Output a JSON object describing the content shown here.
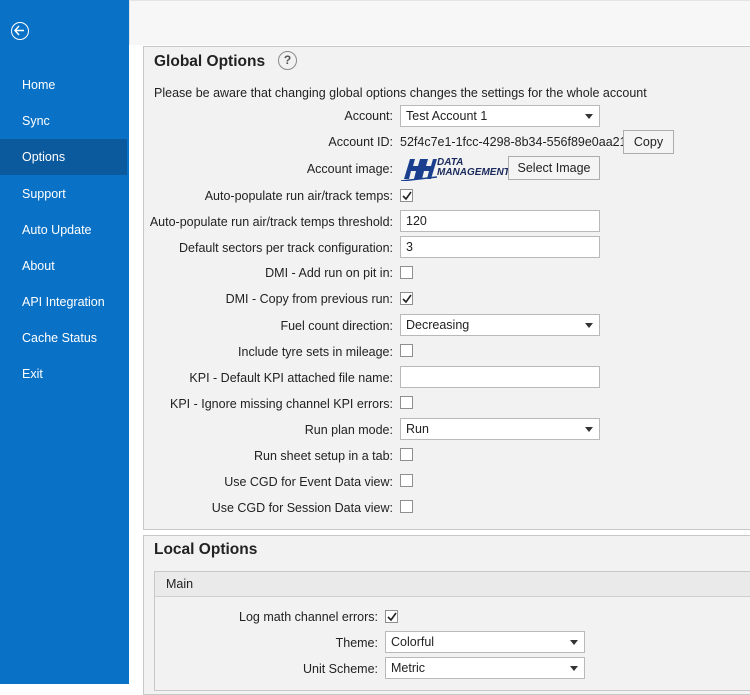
{
  "sidebar": {
    "items": [
      {
        "label": "Home"
      },
      {
        "label": "Sync"
      },
      {
        "label": "Options"
      },
      {
        "label": "Support"
      },
      {
        "label": "Auto Update"
      },
      {
        "label": "About"
      },
      {
        "label": "API Integration"
      },
      {
        "label": "Cache Status"
      },
      {
        "label": "Exit"
      }
    ],
    "active": "Options",
    "accent": "#0a72c6"
  },
  "global": {
    "title": "Global Options",
    "help": "?",
    "note": "Please be aware that changing global options changes the settings for the whole account",
    "account_label": "Account:",
    "account_value": "Test Account 1",
    "account_id_label": "Account ID:",
    "account_id_value": "52f4c7e1-1fcc-4298-8b34-556f89e0aa21",
    "copy_label": "Copy",
    "account_image_label": "Account image:",
    "logo_text_1": "DATA",
    "logo_text_2": "MANAGEMENT",
    "select_image_label": "Select Image",
    "auto_temps_label": "Auto-populate run air/track temps:",
    "auto_temps_checked": true,
    "threshold_label": "Auto-populate run air/track temps threshold:",
    "threshold_value": "120",
    "sectors_label": "Default sectors per track configuration:",
    "sectors_value": "3",
    "dmi_add_label": "DMI - Add run on pit in:",
    "dmi_add_checked": false,
    "dmi_copy_label": "DMI - Copy from previous run:",
    "dmi_copy_checked": true,
    "fuel_label": "Fuel count direction:",
    "fuel_value": "Decreasing",
    "tyre_label": "Include tyre sets in mileage:",
    "tyre_checked": false,
    "kpi_file_label": "KPI - Default KPI attached file name:",
    "kpi_file_value": "",
    "kpi_ignore_label": "KPI - Ignore missing channel KPI errors:",
    "kpi_ignore_checked": false,
    "run_plan_label": "Run plan mode:",
    "run_plan_value": "Run",
    "run_sheet_label": "Run sheet setup in a tab:",
    "run_sheet_checked": false,
    "cgd_event_label": "Use CGD for Event Data view:",
    "cgd_event_checked": false,
    "cgd_session_label": "Use CGD for Session Data view:",
    "cgd_session_checked": false
  },
  "local": {
    "title": "Local Options",
    "main_title": "Main",
    "log_math_label": "Log math channel errors:",
    "log_math_checked": true,
    "theme_label": "Theme:",
    "theme_value": "Colorful",
    "unit_label": "Unit Scheme:",
    "unit_value": "Metric"
  }
}
